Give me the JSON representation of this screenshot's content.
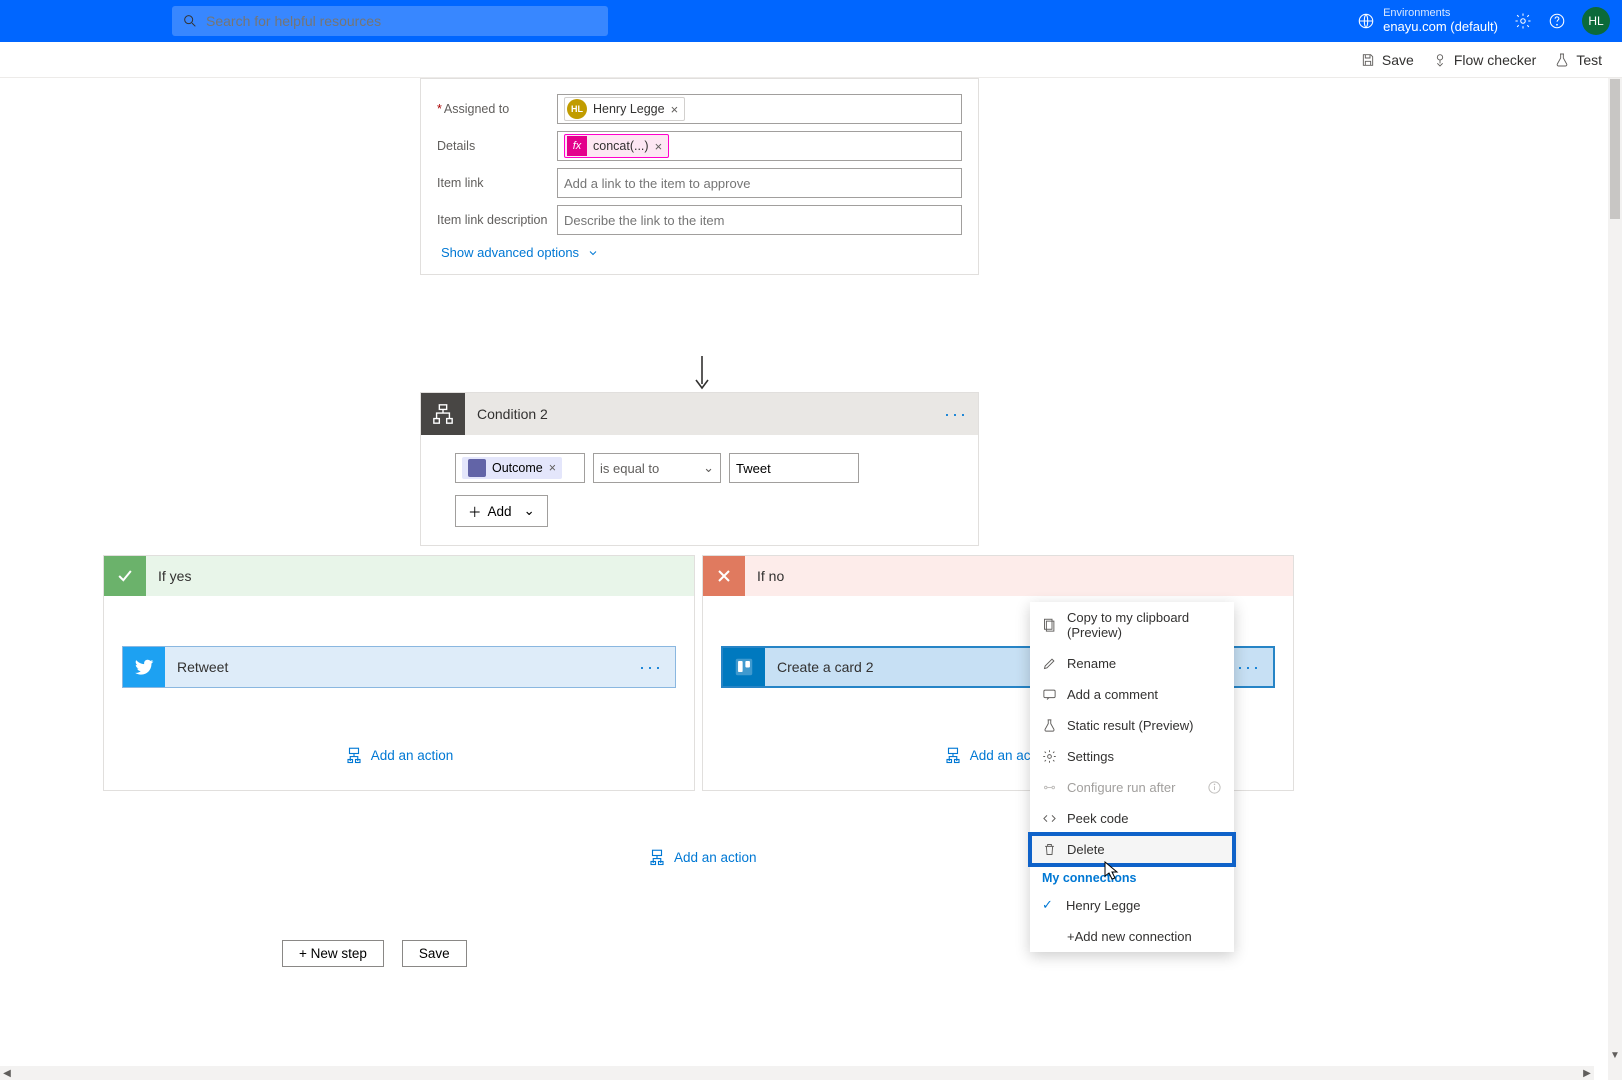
{
  "search": {
    "placeholder": "Search for helpful resources"
  },
  "env": {
    "label": "Environments",
    "name": "enayu.com (default)"
  },
  "avatar": "HL",
  "cmdbar": {
    "save": "Save",
    "flowchecker": "Flow checker",
    "test": "Test"
  },
  "approval": {
    "assigned_label": "Assigned to",
    "assigned_token": "Henry Legge",
    "assigned_initials": "HL",
    "details_label": "Details",
    "details_token": "concat(...)",
    "itemlink_label": "Item link",
    "itemlink_ph": "Add a link to the item to approve",
    "itemdesc_label": "Item link description",
    "itemdesc_ph": "Describe the link to the item",
    "show_adv": "Show advanced options"
  },
  "condition": {
    "title": "Condition 2",
    "outcome": "Outcome",
    "operator": "is equal to",
    "value": "Tweet",
    "add": "Add"
  },
  "branches": {
    "yes": "If yes",
    "no": "If no",
    "retweet": "Retweet",
    "createcard": "Create a card 2",
    "add_action": "Add an action"
  },
  "outer_add": "Add an action",
  "bottom": {
    "newstep": "+ New step",
    "save": "Save"
  },
  "ctx": {
    "copy": "Copy to my clipboard (Preview)",
    "rename": "Rename",
    "comment": "Add a comment",
    "static": "Static result (Preview)",
    "settings": "Settings",
    "runafter": "Configure run after",
    "peek": "Peek code",
    "delete": "Delete",
    "myconn": "My connections",
    "conn1": "Henry Legge",
    "addconn": "+Add new connection"
  }
}
